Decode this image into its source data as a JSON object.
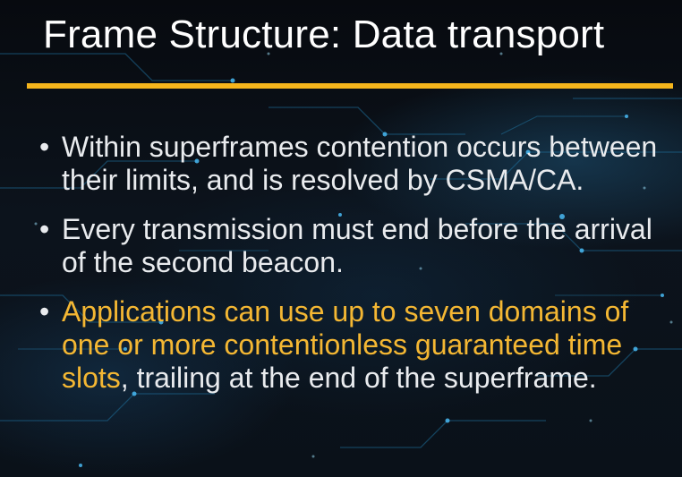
{
  "slide": {
    "title": "Frame Structure: Data transport",
    "colors": {
      "accent_rule": "#f5b51c",
      "text": "#e9ebee",
      "highlight": "#f4b733",
      "background": "#0b1018"
    },
    "bullet_glyph": "•",
    "bullets": [
      {
        "text": "Within superframes contention occurs between their limits, and is resolved by CSMA/CA."
      },
      {
        "text": "Every transmission must end before the arrival of the second beacon."
      },
      {
        "highlight": "Applications can use up to seven domains of one or more contentionless guaranteed time slots",
        "text": ", trailing at the end of the superframe."
      }
    ]
  }
}
